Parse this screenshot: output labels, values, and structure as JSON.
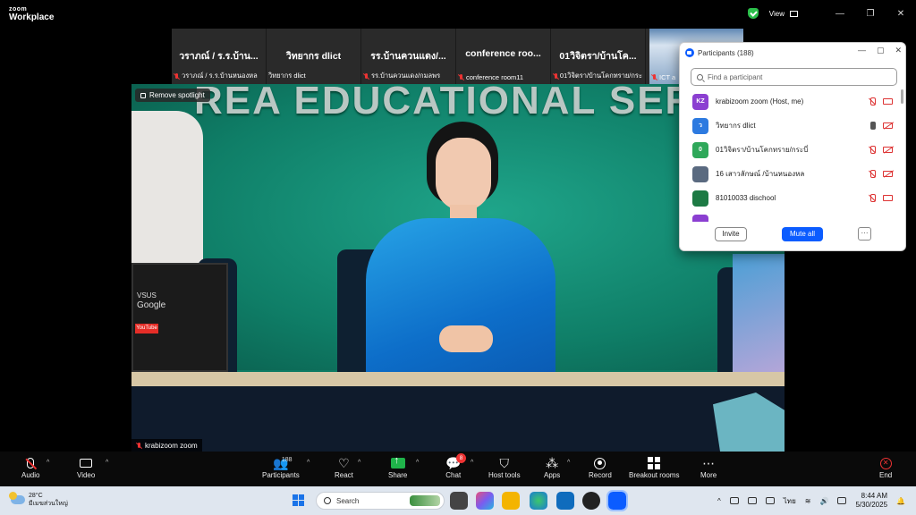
{
  "titlebar": {
    "brand_small": "zoom",
    "brand_big": "Workplace",
    "view_label": "View",
    "minimize": "—",
    "restore": "❐",
    "close": "✕"
  },
  "gallery_strip": [
    {
      "name": "วราภณ์ / ร.ร.บ้าน...",
      "label": "วราภณ์ / ร.ร.บ้านหนองหล"
    },
    {
      "name": "วิทยากร dlict",
      "label": "วิทยากร dlict"
    },
    {
      "name": "รร.บ้านควนแดง/...",
      "label": "รร.บ้านควนแดง/กมลพร"
    },
    {
      "name": "conference roo...",
      "label": "conference room11"
    },
    {
      "name": "01วิจิตรา/บ้านโค...",
      "label": "01วิจิตรา/บ้านโคกทราย/กระ"
    }
  ],
  "ict_thumb_label": "ICT a",
  "main_video": {
    "wall_text": "REA EDUCATIONAL SERVICE",
    "remove_spotlight": "Remove spotlight",
    "speaker_name": "krabizoom zoom",
    "laptop_brand": "VSUS",
    "laptop_text": "Google",
    "laptop_yt": "YouTube"
  },
  "participants_panel": {
    "title": "Participants (188)",
    "search_placeholder": "Find a participant",
    "participants": [
      {
        "initials": "KZ",
        "name": "krabizoom zoom (Host, me)",
        "color": "#8b3fd1",
        "mic": "off",
        "cam": "on"
      },
      {
        "initials": "ว",
        "name": "วิทยากร dlict",
        "color": "#2d7ae0",
        "mic": "on",
        "cam": "off"
      },
      {
        "initials": "0",
        "name": "01วิจิตรา/บ้านโคกทราย/กระบี่",
        "color": "#2fa85a",
        "mic": "off",
        "cam": "off"
      },
      {
        "initials": "",
        "name": "16 เสาวลักษณ์ /บ้านหนองหล",
        "color": "#5a6a80",
        "mic": "off",
        "cam": "off"
      },
      {
        "initials": "",
        "name": "81010033 dischool",
        "color": "#1d7a44",
        "mic": "off",
        "cam": "on"
      }
    ],
    "invite": "Invite",
    "mute_all": "Mute all",
    "more": "···"
  },
  "toolbar": {
    "audio": "Audio",
    "video": "Video",
    "participants": "Participants",
    "participants_count": "188",
    "react": "React",
    "share": "Share",
    "chat": "Chat",
    "chat_badge": "8",
    "host_tools": "Host tools",
    "apps": "Apps",
    "record": "Record",
    "breakout": "Breakout rooms",
    "more": "More",
    "end": "End"
  },
  "taskbar": {
    "temp": "28°C",
    "weather_desc": "มีเมฆส่วนใหญ่",
    "search": "Search",
    "lang": "ไทย",
    "time": "8:44 AM",
    "date": "5/30/2025"
  }
}
